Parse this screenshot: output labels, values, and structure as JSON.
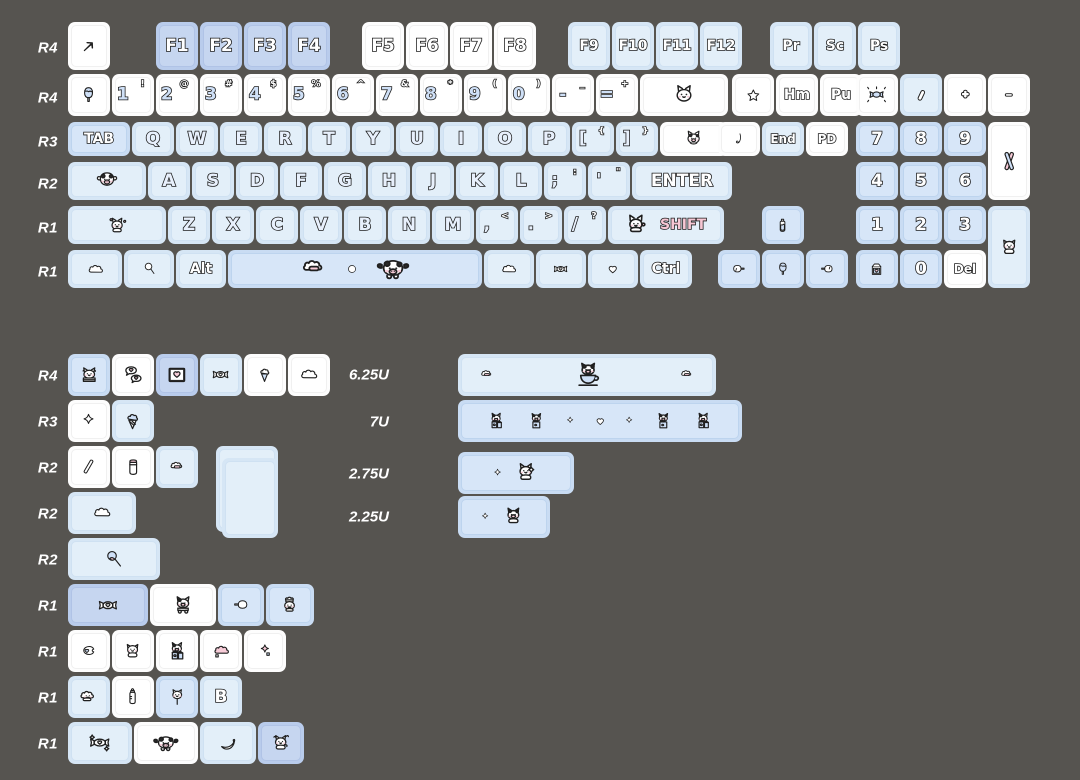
{
  "meta": {
    "background_color": "#565450",
    "white_cap_color": "#ffffff",
    "light_blue_cap_color": "#e3eff9",
    "blue_cap_color": "#c6d6f0",
    "legend_outline_color": "#1d1d1d",
    "pink_accent": "#f6c7d4"
  },
  "main_keyboard": {
    "rows": [
      {
        "label": "R4",
        "keys": [
          {
            "legend": "",
            "icon": "arrow-up-right-icon",
            "color": "white"
          },
          {
            "legend": "F1",
            "color": "blue"
          },
          {
            "legend": "F2",
            "color": "blue"
          },
          {
            "legend": "F3",
            "color": "blue"
          },
          {
            "legend": "F4",
            "color": "blue"
          },
          {
            "legend": "F5",
            "color": "white"
          },
          {
            "legend": "F6",
            "color": "white"
          },
          {
            "legend": "F7",
            "color": "white"
          },
          {
            "legend": "F8",
            "color": "white"
          },
          {
            "legend": "F9",
            "color": "lite"
          },
          {
            "legend": "F10",
            "color": "lite"
          },
          {
            "legend": "F11",
            "color": "lite"
          },
          {
            "legend": "F12",
            "color": "lite"
          },
          {
            "legend": "Pr",
            "color": "lite"
          },
          {
            "legend": "Sc",
            "color": "lite"
          },
          {
            "legend": "Ps",
            "color": "lite"
          }
        ]
      },
      {
        "label": "R4",
        "keys": [
          {
            "legend": "",
            "icon": "popsicle-icon",
            "color": "white"
          },
          {
            "legend": "1",
            "sup": "!",
            "color": "white"
          },
          {
            "legend": "2",
            "sup": "@",
            "color": "white"
          },
          {
            "legend": "3",
            "sup": "#",
            "color": "white"
          },
          {
            "legend": "4",
            "sup": "$",
            "color": "white"
          },
          {
            "legend": "5",
            "sup": "%",
            "color": "white"
          },
          {
            "legend": "6",
            "sup": "^",
            "color": "white"
          },
          {
            "legend": "7",
            "sup": "&",
            "color": "white"
          },
          {
            "legend": "8",
            "sup": "*",
            "color": "white"
          },
          {
            "legend": "9",
            "sup": "(",
            "color": "white"
          },
          {
            "legend": "0",
            "sup": ")",
            "color": "white"
          },
          {
            "legend": "-",
            "sup": "_",
            "color": "white"
          },
          {
            "legend": "=",
            "sup": "+",
            "color": "white"
          },
          {
            "legend": "",
            "icon": "cat-face-icon",
            "color": "white",
            "note": "Backspace"
          },
          {
            "legend": "",
            "icon": "star-outline-icon",
            "color": "white"
          },
          {
            "legend": "Hm",
            "color": "white"
          },
          {
            "legend": "Pu",
            "color": "white"
          },
          {
            "legend": "",
            "icon": "candy-sparkle-icon",
            "color": "white"
          },
          {
            "legend": "",
            "icon": "slash-pill-icon",
            "color": "lite"
          },
          {
            "legend": "",
            "icon": "clover-icon",
            "color": "white"
          },
          {
            "legend": "",
            "icon": "minus-pill-icon",
            "color": "white"
          }
        ]
      },
      {
        "label": "R3",
        "keys": [
          {
            "legend": "TAB",
            "color": "mid"
          },
          {
            "legend": "Q",
            "color": "lite"
          },
          {
            "legend": "W",
            "color": "lite"
          },
          {
            "legend": "E",
            "color": "lite"
          },
          {
            "legend": "R",
            "color": "lite"
          },
          {
            "legend": "T",
            "color": "lite"
          },
          {
            "legend": "Y",
            "color": "lite"
          },
          {
            "legend": "U",
            "color": "lite"
          },
          {
            "legend": "I",
            "color": "lite"
          },
          {
            "legend": "O",
            "color": "lite"
          },
          {
            "legend": "P",
            "color": "lite"
          },
          {
            "legend": "[",
            "sup": "{",
            "color": "lite"
          },
          {
            "legend": "]",
            "sup": "}",
            "color": "lite"
          },
          {
            "legend": "",
            "icon": "cow-cat-icon",
            "color": "white",
            "note": "Backslash"
          },
          {
            "legend": "",
            "icon": "comma-stroke-icon",
            "color": "white"
          },
          {
            "legend": "End",
            "color": "lite"
          },
          {
            "legend": "PD",
            "color": "white"
          },
          {
            "legend": "7",
            "color": "mid"
          },
          {
            "legend": "8",
            "color": "mid"
          },
          {
            "legend": "9",
            "color": "mid"
          },
          {
            "legend": "",
            "icon": "pocky-cross-icon",
            "color": "white",
            "note": "Numpad Plus"
          }
        ]
      },
      {
        "label": "R2",
        "keys": [
          {
            "legend": "",
            "icon": "cow-head-icon",
            "color": "lite",
            "note": "Caps Lock"
          },
          {
            "legend": "A",
            "color": "lite"
          },
          {
            "legend": "S",
            "color": "lite"
          },
          {
            "legend": "D",
            "color": "lite"
          },
          {
            "legend": "F",
            "color": "lite"
          },
          {
            "legend": "G",
            "color": "lite"
          },
          {
            "legend": "H",
            "color": "lite"
          },
          {
            "legend": "J",
            "color": "lite"
          },
          {
            "legend": "K",
            "color": "lite"
          },
          {
            "legend": "L",
            "color": "lite"
          },
          {
            "legend": ";",
            "sup": ":",
            "color": "lite"
          },
          {
            "legend": "'",
            "sup": "\"",
            "color": "lite"
          },
          {
            "legend": "ENTER",
            "color": "lite"
          },
          {
            "legend": "4",
            "color": "mid"
          },
          {
            "legend": "5",
            "color": "mid"
          },
          {
            "legend": "6",
            "color": "mid"
          }
        ]
      },
      {
        "label": "R1",
        "keys": [
          {
            "legend": "",
            "icon": "cat-bow-icon",
            "color": "lite",
            "note": "Left Shift"
          },
          {
            "legend": "Z",
            "color": "lite"
          },
          {
            "legend": "X",
            "color": "lite"
          },
          {
            "legend": "C",
            "color": "lite"
          },
          {
            "legend": "V",
            "color": "lite"
          },
          {
            "legend": "B",
            "color": "lite"
          },
          {
            "legend": "N",
            "color": "lite"
          },
          {
            "legend": "M",
            "color": "lite"
          },
          {
            "legend": ",",
            "sup": "<",
            "color": "lite"
          },
          {
            "legend": ".",
            "sup": ">",
            "color": "lite"
          },
          {
            "legend": "/",
            "sup": "?",
            "color": "lite"
          },
          {
            "legend": "SHIFT",
            "icon": "cat-shift-icon",
            "color": "lite"
          },
          {
            "legend": "",
            "icon": "milk-bottle-icon",
            "color": "mid",
            "note": "Arrow Up"
          },
          {
            "legend": "1",
            "color": "mid"
          },
          {
            "legend": "2",
            "color": "mid"
          },
          {
            "legend": "3",
            "color": "mid"
          },
          {
            "legend": "",
            "icon": "cat-sitting-icon",
            "color": "lite",
            "note": "Numpad Enter"
          }
        ]
      },
      {
        "label": "R1",
        "keys": [
          {
            "legend": "",
            "icon": "cloud-icon",
            "color": "lite",
            "note": "Ctrl"
          },
          {
            "legend": "",
            "icon": "magnifier-icon",
            "color": "lite",
            "note": "Win"
          },
          {
            "legend": "Alt",
            "color": "lite"
          },
          {
            "legend": "",
            "icon": "spacebar-cow-icon",
            "color": "mid",
            "note": "Spacebar"
          },
          {
            "legend": "",
            "icon": "cloud-icon",
            "color": "lite"
          },
          {
            "legend": "",
            "icon": "candy-heart-icon",
            "color": "lite"
          },
          {
            "legend": "",
            "icon": "heart-outline-icon",
            "color": "lite"
          },
          {
            "legend": "Ctrl",
            "color": "lite"
          },
          {
            "legend": "",
            "icon": "popsicle-left-icon",
            "color": "mid",
            "note": "Arrow Left"
          },
          {
            "legend": "",
            "icon": "popsicle-icon",
            "color": "mid",
            "note": "Arrow Down"
          },
          {
            "legend": "",
            "icon": "popsicle-right-icon",
            "color": "mid",
            "note": "Arrow Right"
          },
          {
            "legend": "",
            "icon": "milk-carton-icon",
            "color": "mid",
            "note": "Numpad 0"
          },
          {
            "legend": "0",
            "color": "mid"
          },
          {
            "legend": "Del",
            "color": "white"
          }
        ]
      }
    ]
  },
  "novelty_section": {
    "rows": [
      {
        "label": "R4",
        "keys": [
          {
            "icon": "cat-cake-icon",
            "color": "mid"
          },
          {
            "icon": "heart-bubbles-icon",
            "color": "white"
          },
          {
            "icon": "heart-frame-icon",
            "color": "blue"
          },
          {
            "icon": "candy-heart-icon",
            "color": "lite"
          },
          {
            "icon": "soft-serve-icon",
            "color": "white"
          },
          {
            "icon": "cloud-icon",
            "color": "white"
          }
        ]
      },
      {
        "label": "R3",
        "keys": [
          {
            "icon": "sparkle-icon",
            "color": "white"
          },
          {
            "icon": "ice-cream-cone-icon",
            "color": "lite"
          }
        ]
      },
      {
        "label": "R2",
        "keys": [
          {
            "icon": "pocky-stick-icon",
            "color": "white"
          },
          {
            "icon": "milk-jar-icon",
            "color": "white"
          },
          {
            "icon": "cloud-pill-icon",
            "color": "lite"
          },
          {
            "icon": "iso-enter-cat-icon",
            "color": "lite",
            "shape": "iso-enter"
          }
        ]
      },
      {
        "label": "R2",
        "keys": [
          {
            "icon": "cloud-icon",
            "color": "lite"
          }
        ]
      },
      {
        "label": "R2",
        "keys": [
          {
            "icon": "lollipop-icon",
            "color": "lite",
            "width": "2u"
          }
        ]
      },
      {
        "label": "R1",
        "keys": [
          {
            "icon": "candy-heart-icon",
            "color": "blue",
            "width": "1.75u"
          },
          {
            "icon": "cow-cart-icon",
            "color": "white",
            "width": "1.5u"
          },
          {
            "icon": "popsicle-flat-icon",
            "color": "mid"
          },
          {
            "icon": "cat-chef-icon",
            "color": "mid"
          }
        ]
      },
      {
        "label": "R1",
        "keys": [
          {
            "icon": "fish-candy-icon",
            "color": "white"
          },
          {
            "icon": "cat-sitting-icon",
            "color": "white"
          },
          {
            "icon": "cow-milk-icon",
            "color": "white"
          },
          {
            "icon": "pink-cloud-icon",
            "color": "white"
          },
          {
            "icon": "pink-star-icon",
            "color": "white"
          }
        ]
      },
      {
        "label": "R1",
        "keys": [
          {
            "icon": "cat-cloud-icon",
            "color": "lite"
          },
          {
            "icon": "baby-bottle-icon",
            "color": "white"
          },
          {
            "icon": "cat-lollipop-icon",
            "color": "mid"
          },
          {
            "icon": "B",
            "legend": "B",
            "color": "lite"
          }
        ]
      },
      {
        "label": "R1",
        "keys": [
          {
            "icon": "sparkle-candy-icon",
            "color": "lite",
            "width": "1.5u"
          },
          {
            "icon": "cow-face-icon",
            "color": "white",
            "width": "1.5u"
          },
          {
            "icon": "banana-icon",
            "color": "lite",
            "width": "1.25u"
          },
          {
            "icon": "cat-wave-icon",
            "color": "blue"
          }
        ]
      }
    ]
  },
  "large_keys": [
    {
      "size_label": "6.25U",
      "icon": "cow-teacup-spacebar-icon",
      "color": "lite"
    },
    {
      "size_label": "7U",
      "icon": "cow-parade-spacebar-icon",
      "color": "mid"
    },
    {
      "size_label": "2.75U",
      "icon": "cat-sparkle-icon",
      "color": "mid"
    },
    {
      "size_label": "2.25U",
      "icon": "cow-sparkle-icon",
      "color": "mid"
    }
  ]
}
